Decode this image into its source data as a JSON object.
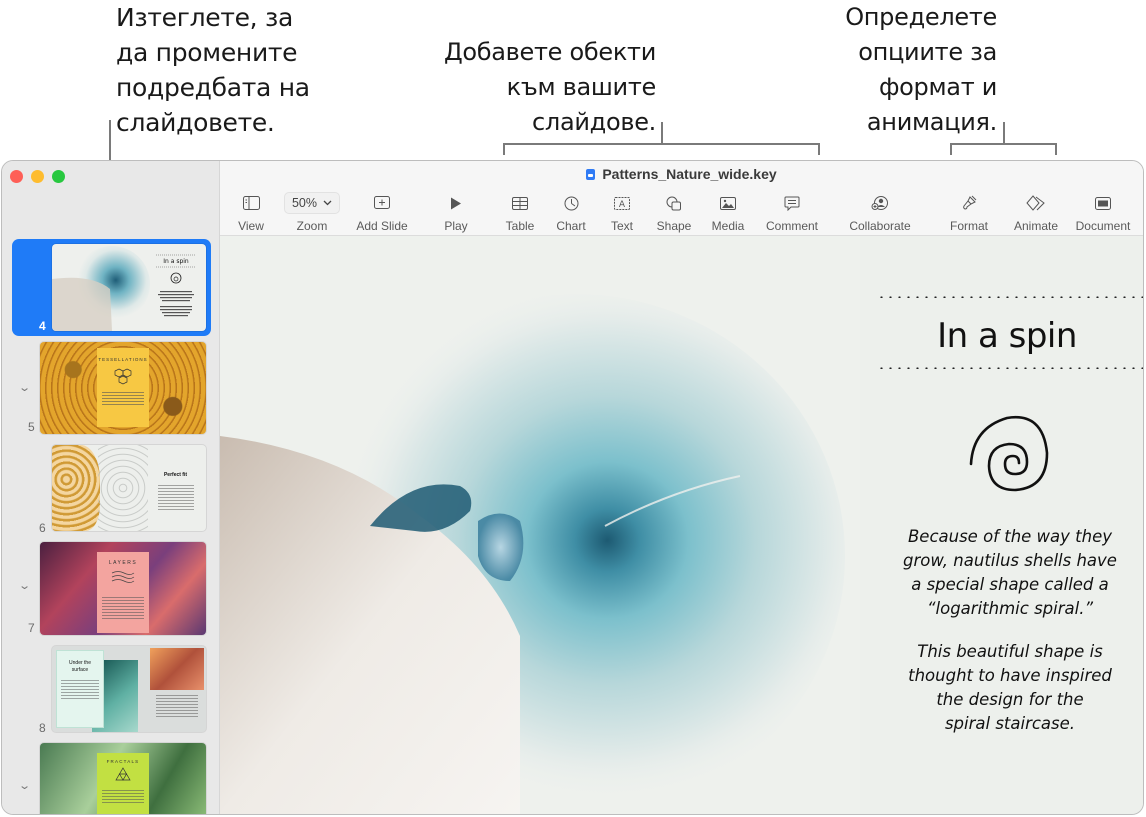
{
  "callouts": {
    "left": [
      "Изтеглете, за",
      "да промените",
      "подредбата на",
      "слайдовете."
    ],
    "middle": [
      "Добавете обекти",
      "към вашите",
      "слайдове."
    ],
    "right": [
      "Определете",
      "опциите за",
      "формат и",
      "анимация."
    ]
  },
  "window": {
    "title": "Patterns_Nature_wide.key",
    "traffic_colors": {
      "close": "#fe5f57",
      "minimize": "#febc2e",
      "zoom": "#28c840"
    }
  },
  "toolbar": {
    "view": {
      "label": "View",
      "icon": "sidebar-icon"
    },
    "zoom": {
      "label": "Zoom",
      "value": "50%",
      "icon": "chevron-down-icon"
    },
    "add_slide": {
      "label": "Add Slide",
      "icon": "plus-square-icon"
    },
    "play": {
      "label": "Play",
      "icon": "play-icon"
    },
    "table": {
      "label": "Table",
      "icon": "table-icon"
    },
    "chart": {
      "label": "Chart",
      "icon": "chart-icon"
    },
    "text": {
      "label": "Text",
      "icon": "text-box-icon"
    },
    "shape": {
      "label": "Shape",
      "icon": "shape-icon"
    },
    "media": {
      "label": "Media",
      "icon": "media-icon"
    },
    "comment": {
      "label": "Comment",
      "icon": "comment-icon"
    },
    "collaborate": {
      "label": "Collaborate",
      "icon": "collaborate-icon"
    },
    "format": {
      "label": "Format",
      "icon": "paintbrush-icon"
    },
    "animate": {
      "label": "Animate",
      "icon": "animate-icon"
    },
    "document": {
      "label": "Document",
      "icon": "document-icon"
    }
  },
  "slides": [
    {
      "number": "4",
      "title": "In a spin",
      "selected": true
    },
    {
      "number": "5",
      "title": "TESSELLATIONS",
      "collapsible": true
    },
    {
      "number": "6",
      "title": "Perfect fit"
    },
    {
      "number": "7",
      "title": "LAYERS",
      "collapsible": true
    },
    {
      "number": "8",
      "title": "Under the surface"
    },
    {
      "number": "",
      "title": "FRACTALS",
      "collapsible": true
    }
  ],
  "current_slide": {
    "title": "In a spin",
    "paragraph1": [
      "Because of the way they",
      "grow, nautilus shells have",
      "a special shape called a",
      "“logarithmic spiral.”"
    ],
    "paragraph2": [
      "This beautiful shape is",
      "thought to have inspired",
      "the design for the",
      "spiral staircase."
    ]
  }
}
